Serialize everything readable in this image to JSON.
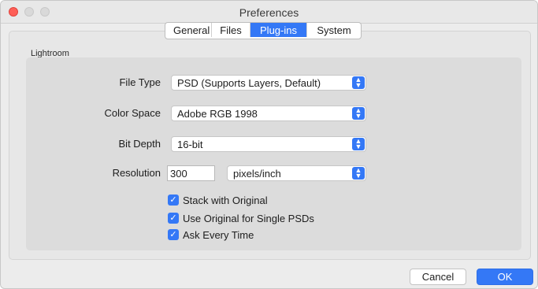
{
  "window": {
    "title": "Preferences"
  },
  "tabs": [
    {
      "label": "General",
      "active": false
    },
    {
      "label": "Files",
      "active": false
    },
    {
      "label": "Plug-ins",
      "active": true
    },
    {
      "label": "System",
      "active": false
    }
  ],
  "group": {
    "label": "Lightroom"
  },
  "fields": {
    "file_type": {
      "label": "File Type",
      "value": "PSD (Supports Layers, Default)"
    },
    "color_space": {
      "label": "Color Space",
      "value": "Adobe RGB 1998"
    },
    "bit_depth": {
      "label": "Bit Depth",
      "value": "16-bit"
    },
    "resolution": {
      "label": "Resolution",
      "value": "300",
      "unit": "pixels/inch"
    }
  },
  "checkboxes": [
    {
      "label": "Stack with Original",
      "checked": true
    },
    {
      "label": "Use Original for Single PSDs",
      "checked": true
    },
    {
      "label": "Ask Every Time",
      "checked": true
    }
  ],
  "buttons": {
    "cancel": "Cancel",
    "ok": "OK"
  },
  "colors": {
    "accent": "#3478f6",
    "close_light": "#fe5f57"
  }
}
